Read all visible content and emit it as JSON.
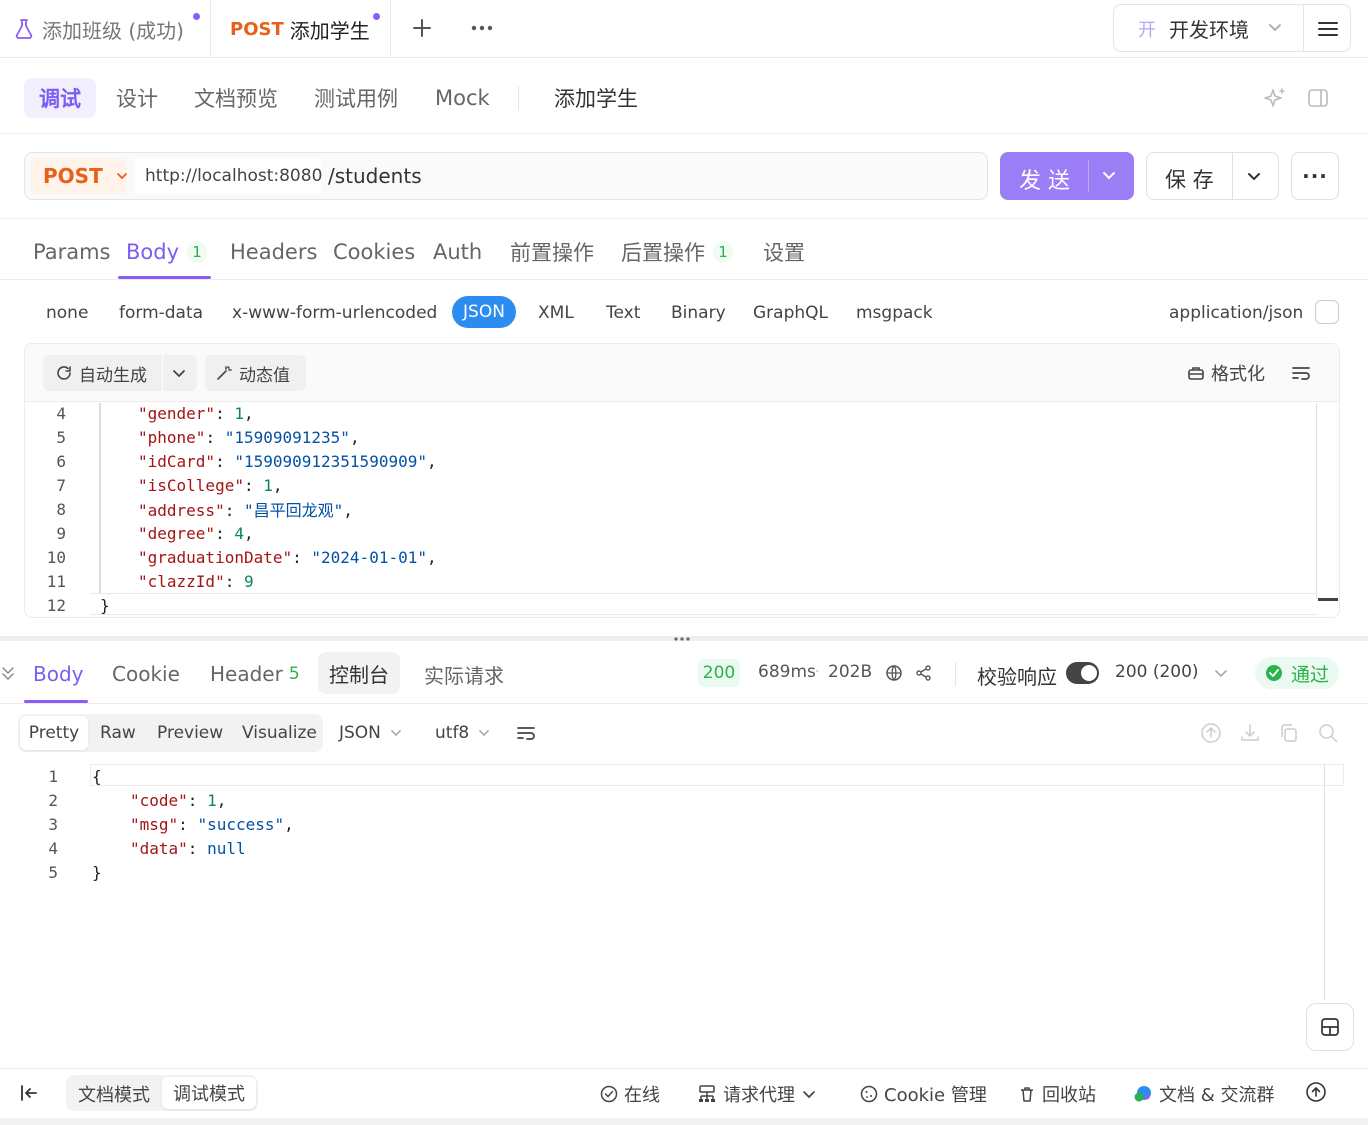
{
  "tabs": {
    "tab1_label": "添加班级 (成功)",
    "tab2_method": "POST",
    "tab2_label": "添加学生",
    "add_symbol": "+",
    "more_symbol": "···"
  },
  "environment": {
    "prefix": "开",
    "label": "开发环境"
  },
  "mode_tabs": {
    "debug": "调试",
    "design": "设计",
    "doc_preview": "文档预览",
    "test_cases": "测试用例",
    "mock": "Mock",
    "api_name": "添加学生"
  },
  "request": {
    "method": "POST",
    "host": "http://localhost:8080",
    "path": "/students",
    "send_label": "发 送",
    "save_label": "保 存",
    "more_label": "···"
  },
  "request_tabs": {
    "params": "Params",
    "body": "Body",
    "body_count": "1",
    "headers": "Headers",
    "cookies": "Cookies",
    "auth": "Auth",
    "pre_ops": "前置操作",
    "post_ops": "后置操作",
    "post_count": "1",
    "settings": "设置"
  },
  "body_types": {
    "none": "none",
    "form_data": "form-data",
    "urlencoded": "x-www-form-urlencoded",
    "json": "JSON",
    "xml": "XML",
    "text": "Text",
    "binary": "Binary",
    "graphql": "GraphQL",
    "msgpack": "msgpack",
    "content_type": "application/json"
  },
  "editor_toolbar": {
    "auto_generate": "自动生成",
    "dynamic_value": "动态值",
    "format": "格式化"
  },
  "request_body_lines": [
    {
      "ln": "4",
      "key": "\"gender\"",
      "val": "1",
      "vtype": "n",
      "comma": ","
    },
    {
      "ln": "5",
      "key": "\"phone\"",
      "val": "\"15909091235\"",
      "vtype": "s",
      "comma": ","
    },
    {
      "ln": "6",
      "key": "\"idCard\"",
      "val": "\"159090912351590909\"",
      "vtype": "s",
      "comma": ","
    },
    {
      "ln": "7",
      "key": "\"isCollege\"",
      "val": "1",
      "vtype": "n",
      "comma": ","
    },
    {
      "ln": "8",
      "key": "\"address\"",
      "val": "\"昌平回龙观\"",
      "vtype": "s",
      "comma": ","
    },
    {
      "ln": "9",
      "key": "\"degree\"",
      "val": "4",
      "vtype": "n",
      "comma": ","
    },
    {
      "ln": "10",
      "key": "\"graduationDate\"",
      "val": "\"2024-01-01\"",
      "vtype": "s",
      "comma": ","
    },
    {
      "ln": "11",
      "key": "\"clazzId\"",
      "val": "9",
      "vtype": "n",
      "comma": ""
    },
    {
      "ln": "12",
      "key": "}",
      "val": "",
      "vtype": "p",
      "comma": ""
    }
  ],
  "response_tabs": {
    "body": "Body",
    "cookie": "Cookie",
    "header": "Header",
    "header_count": "5",
    "console": "控制台",
    "actual_request": "实际请求"
  },
  "response_status": {
    "code": "200",
    "time": "689ms",
    "size": "202B",
    "validate_label": "校验响应",
    "status_text": "200 (200)",
    "pass_label": "通过"
  },
  "response_format": {
    "pretty": "Pretty",
    "raw": "Raw",
    "preview": "Preview",
    "visualize": "Visualize",
    "json": "JSON",
    "encoding": "utf8"
  },
  "response_lines": [
    {
      "ln": "1",
      "text": "{"
    },
    {
      "ln": "2",
      "key": "\"code\"",
      "val": "1",
      "vtype": "n",
      "comma": ","
    },
    {
      "ln": "3",
      "key": "\"msg\"",
      "val": "\"success\"",
      "vtype": "s",
      "comma": ","
    },
    {
      "ln": "4",
      "key": "\"data\"",
      "val": "null",
      "vtype": "s",
      "comma": ""
    },
    {
      "ln": "5",
      "text": "}"
    }
  ],
  "footer": {
    "doc_mode": "文档模式",
    "debug_mode": "调试模式",
    "online": "在线",
    "proxy": "请求代理",
    "cookie_mgmt": "Cookie 管理",
    "recycle": "回收站",
    "docs_community": "文档 & 交流群"
  },
  "colors": {
    "accent": "#8b5cf6",
    "post_method": "#e8611a",
    "success": "#2bb24c",
    "json_chip": "#2d8cf0"
  }
}
